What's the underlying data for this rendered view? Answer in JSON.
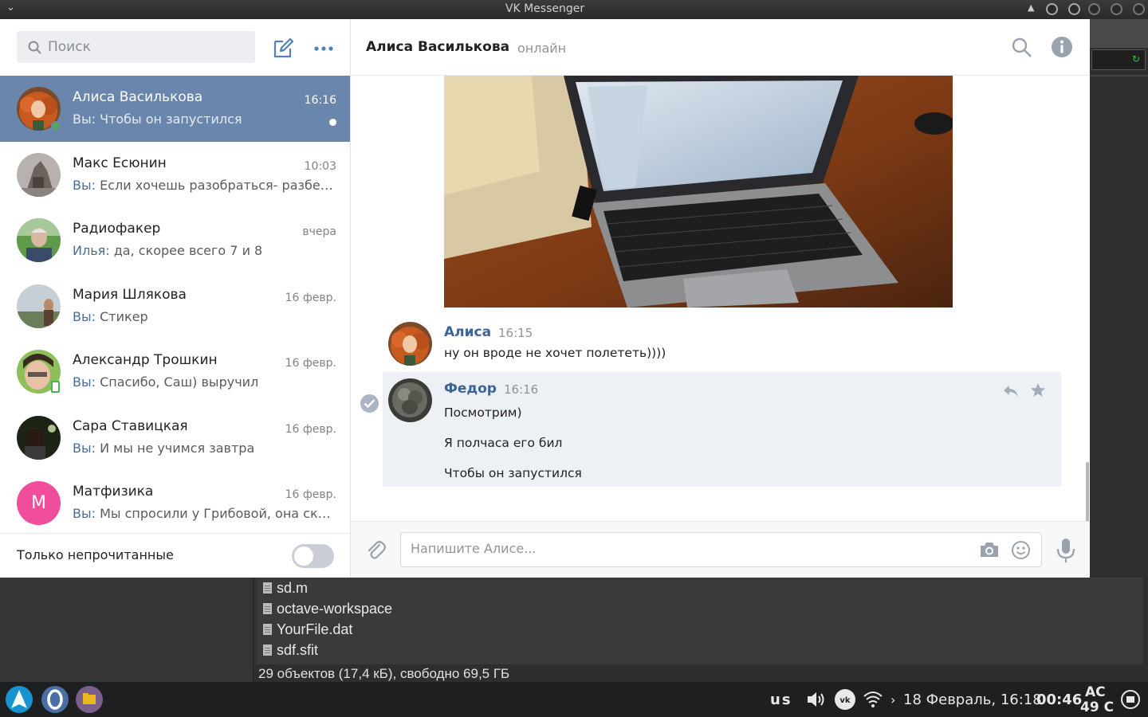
{
  "window": {
    "title": "VK Messenger"
  },
  "sidebar": {
    "search_placeholder": "Поиск",
    "dialogs": [
      {
        "name": "Алиса Василькова",
        "time": "16:16",
        "who": "Вы:",
        "preview": "Чтобы он запустился",
        "active": true,
        "online": true,
        "unread": true
      },
      {
        "name": "Макс Есюнин",
        "time": "10:03",
        "who": "Вы:",
        "preview": "Если хочешь разобраться- разбере…"
      },
      {
        "name": "Радиофакер",
        "time": "вчера",
        "who": "Илья:",
        "preview": "да, скорее всего 7 и 8"
      },
      {
        "name": "Мария Шлякова",
        "time": "16 февр.",
        "who": "Вы:",
        "preview": "Стикер"
      },
      {
        "name": "Александр Трошкин",
        "time": "16 февр.",
        "who": "Вы:",
        "preview": "Спасибо, Саш) выручил",
        "mobile": true
      },
      {
        "name": "Сара Ставицкая",
        "time": "16 февр.",
        "who": "Вы:",
        "preview": "И мы не учимся завтра"
      },
      {
        "name": "Матфизика",
        "time": "16 февр.",
        "who": "Вы:",
        "preview": "Мы спросили у Грибовой, она сказа…",
        "letter": "М"
      }
    ],
    "only_unread_label": "Только непрочитанные",
    "only_unread_enabled": false
  },
  "chat": {
    "peer_name": "Алиса Василькова",
    "peer_status": "онлайн",
    "messages": [
      {
        "author": "Алиса",
        "time": "16:15",
        "lines": [
          "ну он вроде не хочет полететь))))"
        ]
      },
      {
        "author": "Федор",
        "time": "16:16",
        "lines": [
          "Посмотрим)",
          "Я полчаса его бил",
          "Чтобы он запустился"
        ],
        "selected": true
      }
    ],
    "composer_placeholder": "Напишите Алисе..."
  },
  "file_manager": {
    "files": [
      "sd.m",
      "octave-workspace",
      "YourFile.dat",
      "sdf.sfit"
    ],
    "status": "29 объектов (17,4 кБ), свободно 69,5 ГБ"
  },
  "taskbar": {
    "layout": "us",
    "datetime": "18 Февраль, 16:18",
    "clock": "00:46",
    "power_line1": "AC",
    "power_line2": "49 C"
  },
  "colors": {
    "accent": "#5181b8",
    "active_dialog": "#6a86ad",
    "author_name": "#3c6496",
    "online": "#4bb34b"
  }
}
